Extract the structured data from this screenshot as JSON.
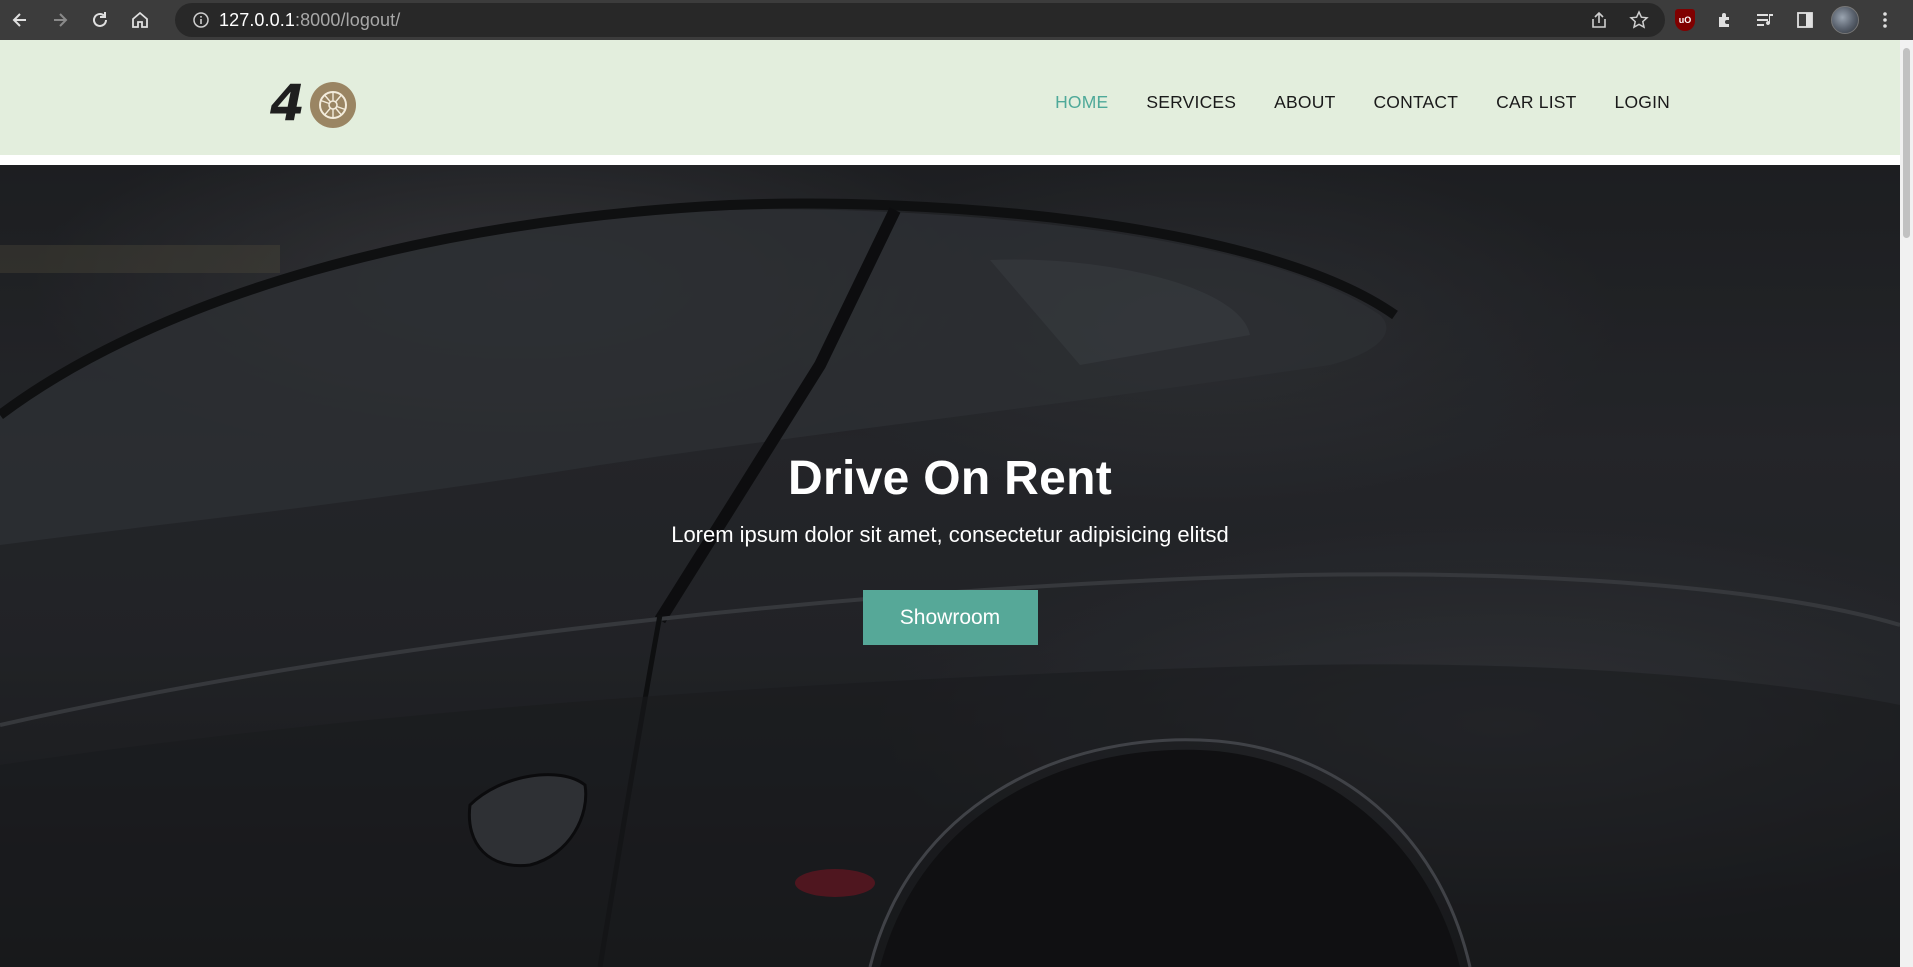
{
  "browser": {
    "url_host": "127.0.0.1",
    "url_path": ":8000/logout/",
    "nav_icons": [
      "back-icon",
      "forward-icon",
      "reload-icon",
      "home-icon"
    ],
    "omnibox_icons": [
      "info-icon",
      "share-icon",
      "bookmark-star-icon"
    ],
    "toolbar_icons": [
      "ublock-icon",
      "extensions-icon",
      "reading-list-icon",
      "side-panel-icon",
      "profile-avatar",
      "menu-icon"
    ],
    "ublock_label": "uO"
  },
  "header": {
    "logo_text": "4",
    "nav": [
      {
        "label": "HOME",
        "active": true
      },
      {
        "label": "SERVICES",
        "active": false
      },
      {
        "label": "ABOUT",
        "active": false
      },
      {
        "label": "CONTACT",
        "active": false
      },
      {
        "label": "CAR LIST",
        "active": false
      },
      {
        "label": "LOGIN",
        "active": false
      }
    ]
  },
  "hero": {
    "title": "Drive On Rent",
    "subtitle": "Lorem ipsum dolor sit amet, consectetur adipisicing elitsd",
    "button_label": "Showroom"
  },
  "colors": {
    "header_bg": "#e3eedd",
    "accent": "#56a898",
    "nav_active": "#4ea999",
    "chrome_bg": "#3c3c3c"
  }
}
